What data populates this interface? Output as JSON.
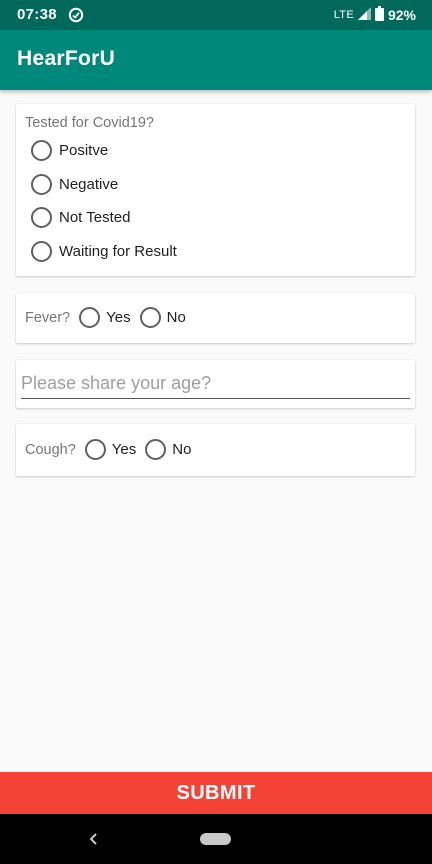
{
  "status_bar": {
    "time": "07:38",
    "network": "LTE",
    "battery": "92%",
    "icons": [
      "sync-icon",
      "signal-icon",
      "battery-icon"
    ]
  },
  "app_bar": {
    "title": "HearForU"
  },
  "covid_question": {
    "label": "Tested for Covid19?",
    "options": [
      "Positve",
      "Negative",
      "Not Tested",
      "Waiting for Result"
    ]
  },
  "fever_question": {
    "label": "Fever?",
    "options": [
      "Yes",
      "No"
    ]
  },
  "age_field": {
    "placeholder": "Please share your age?",
    "value": ""
  },
  "cough_question": {
    "label": "Cough?",
    "options": [
      "Yes",
      "No"
    ]
  },
  "submit": {
    "label": "SUBMIT"
  },
  "colors": {
    "status_bar": "#00695c",
    "app_bar": "#00897b",
    "submit": "#f44336",
    "background": "#fafafa"
  }
}
